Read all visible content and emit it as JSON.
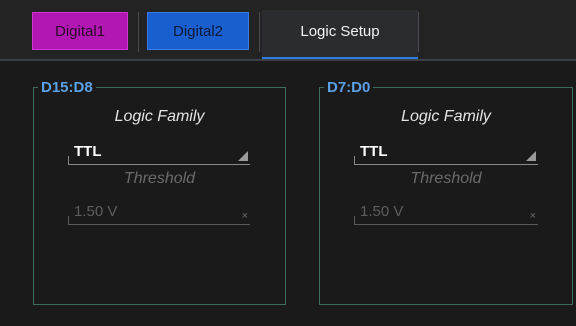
{
  "tabs": {
    "digital1": "Digital1",
    "digital2": "Digital2",
    "logic_setup": "Logic Setup"
  },
  "groups": [
    {
      "title": "D15:D8",
      "logic_family_label": "Logic Family",
      "logic_family_value": "TTL",
      "threshold_label": "Threshold",
      "threshold_value": "1.50 V"
    },
    {
      "title": "D7:D0",
      "logic_family_label": "Logic Family",
      "logic_family_value": "TTL",
      "threshold_label": "Threshold",
      "threshold_value": "1.50 V"
    }
  ],
  "colors": {
    "digital1": "#b317b3",
    "digital2": "#1a5fd0",
    "active_underline": "#2e7de0",
    "group_title": "#5aa0e6",
    "group_border": "#3d6b5c"
  },
  "icons": {
    "dropdown": "dropdown-triangle-icon",
    "clear": "clear-x-icon"
  }
}
